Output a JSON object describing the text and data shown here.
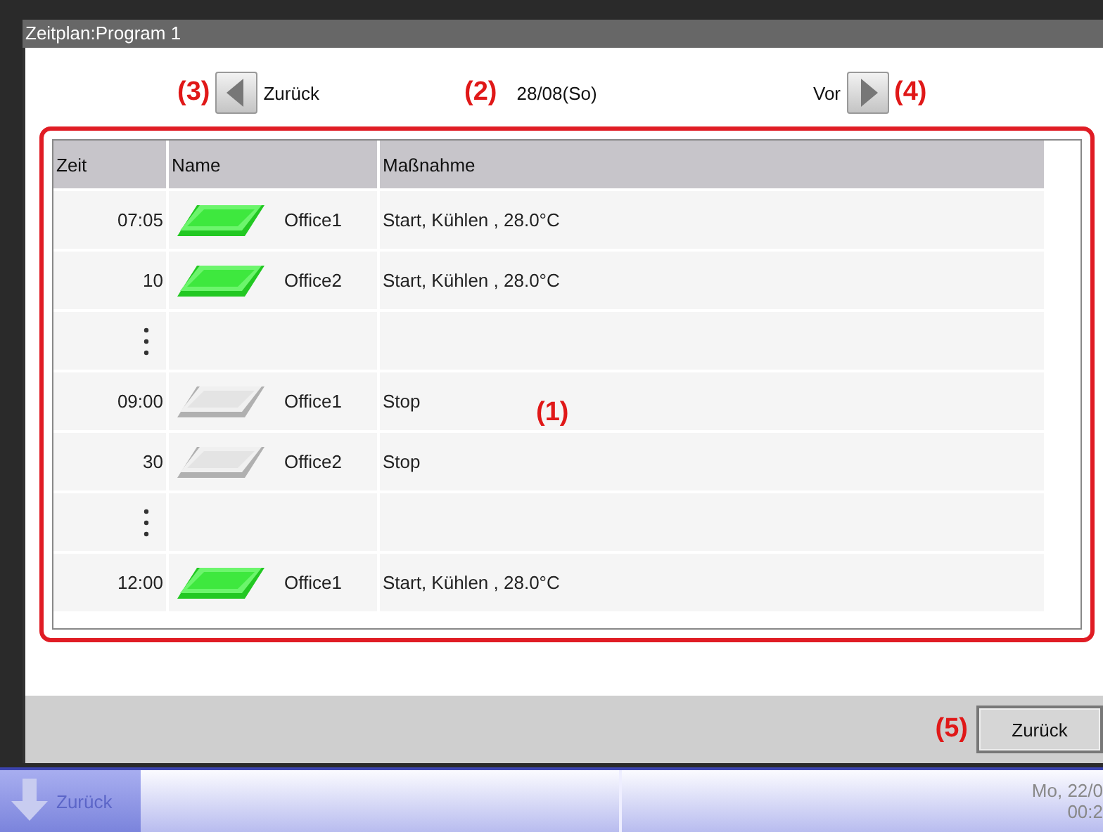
{
  "window": {
    "title": "Zeitplan:Program 1"
  },
  "navigation": {
    "previous": {
      "label": "Zurück",
      "marker": "(3)"
    },
    "date": {
      "text": "28/08(So)",
      "marker": "(2)"
    },
    "next": {
      "label": "Vor",
      "marker": "(4)"
    }
  },
  "table": {
    "marker": "(1)",
    "columns": [
      "Zeit",
      "Name",
      "Maßnahme"
    ],
    "rows": [
      {
        "kind": "entry",
        "time": "07:05",
        "name": "Office1",
        "action": "Start, Kühlen , 28.0°C",
        "on": true
      },
      {
        "kind": "entry",
        "time": "10",
        "name": "Office2",
        "action": "Start, Kühlen , 28.0°C",
        "on": true
      },
      {
        "kind": "ellipsis"
      },
      {
        "kind": "entry",
        "time": "09:00",
        "name": "Office1",
        "action": "Stop",
        "on": false
      },
      {
        "kind": "entry",
        "time": "30",
        "name": "Office2",
        "action": "Stop",
        "on": false
      },
      {
        "kind": "ellipsis"
      },
      {
        "kind": "entry",
        "time": "12:00",
        "name": "Office1",
        "action": "Start, Kühlen , 28.0°C",
        "on": true
      }
    ]
  },
  "footer": {
    "button": "Zurück",
    "marker": "(5)"
  },
  "taskbar": {
    "back_button": {
      "label": "Zurück",
      "disabled": true
    },
    "date": "Mo, 22/0",
    "time": "00:2"
  }
}
